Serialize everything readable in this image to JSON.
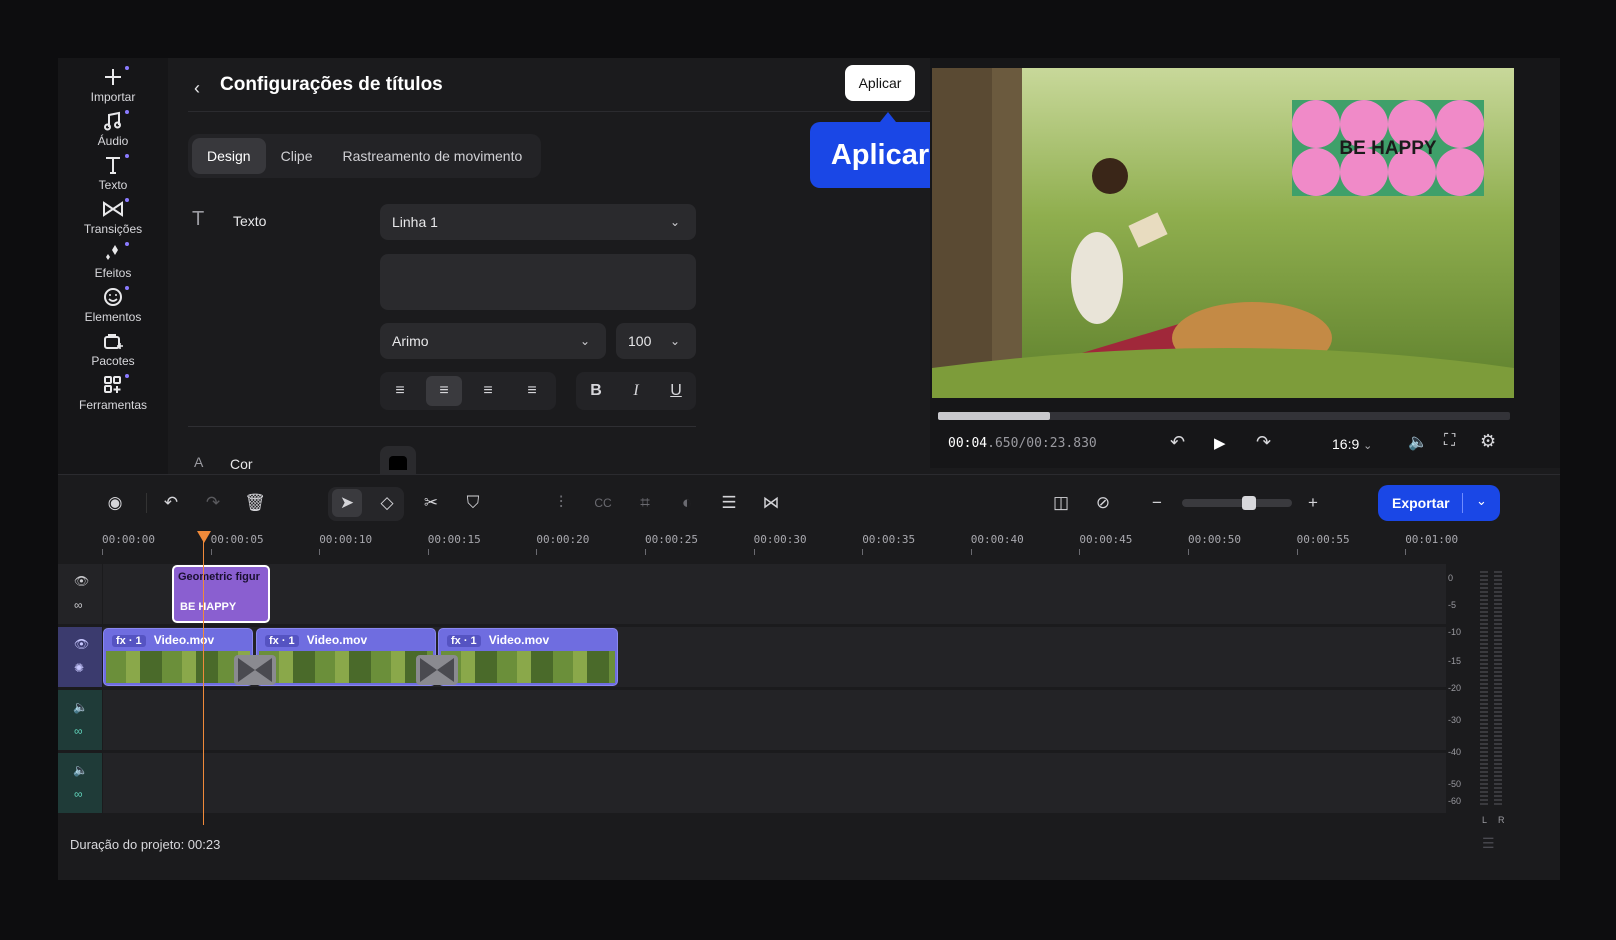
{
  "sidebar": {
    "items": [
      {
        "label": "Importar",
        "icon": "plus-icon"
      },
      {
        "label": "Áudio",
        "icon": "music-note-icon"
      },
      {
        "label": "Texto",
        "icon": "text-icon"
      },
      {
        "label": "Transições",
        "icon": "transitions-icon"
      },
      {
        "label": "Efeitos",
        "icon": "sparkle-icon"
      },
      {
        "label": "Elementos",
        "icon": "smiley-icon"
      },
      {
        "label": "Pacotes",
        "icon": "bag-icon"
      },
      {
        "label": "Ferramentas",
        "icon": "grid-plus-icon"
      }
    ]
  },
  "panel": {
    "title": "Configurações de títulos",
    "apply_button": "Aplicar",
    "callout": "Aplicar",
    "tabs": [
      "Design",
      "Clipe",
      "Rastreamento de movimento"
    ],
    "text_label": "Texto",
    "line_select": "Linha 1",
    "font_select": "Arimo",
    "size_select": "100",
    "color_label": "Cor"
  },
  "preview": {
    "overlay_text": "BE HAPPY",
    "timecode_current": "00:04",
    "timecode_ms": ".650",
    "timecode_total": "/00:23.830",
    "aspect": "16:9",
    "progress": 0.196
  },
  "toolbar": {
    "export_label": "Exportar"
  },
  "ruler": [
    "00:00:00",
    "00:00:05",
    "00:00:10",
    "00:00:15",
    "00:00:20",
    "00:00:25",
    "00:00:30",
    "00:00:35",
    "00:00:40",
    "00:00:45",
    "00:00:50",
    "00:00:55",
    "00:01:00"
  ],
  "tracks": {
    "title_clip": {
      "name": "Geometric figur",
      "text": "BE HAPPY"
    },
    "video_clips": [
      {
        "badge": "fx · 1",
        "name": "Video.mov"
      },
      {
        "badge": "fx · 1",
        "name": "Video.mov"
      },
      {
        "badge": "fx · 1",
        "name": "Video.mov"
      }
    ]
  },
  "meter": {
    "labels": [
      "0",
      "-5",
      "-10",
      "-15",
      "-20",
      "-30",
      "-40",
      "-50",
      "-60"
    ],
    "channels": [
      "L",
      "R"
    ]
  },
  "footer": {
    "duration": "Duração do projeto: 00:23"
  },
  "colors": {
    "accent": "#1a47e6",
    "clip": "#6f6de0",
    "playhead": "#f08a3a"
  }
}
